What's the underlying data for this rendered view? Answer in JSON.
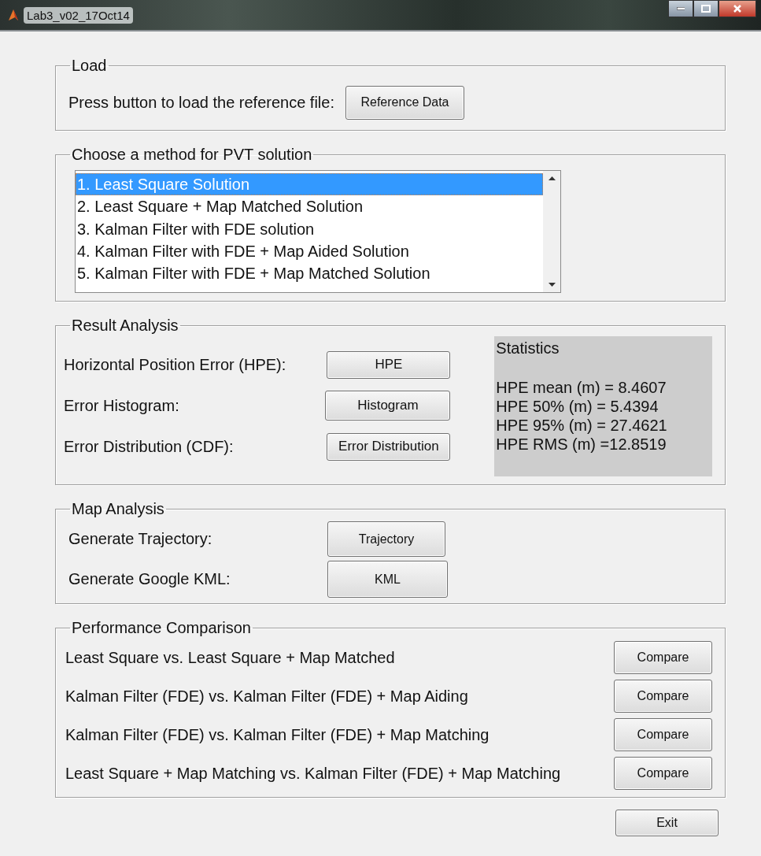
{
  "window": {
    "title": "Lab3_v02_17Oct14"
  },
  "load": {
    "title": "Load",
    "label": "Press button to load the reference file:",
    "button": "Reference Data"
  },
  "method": {
    "title": "Choose a method for PVT solution",
    "items": [
      {
        "label": "1. Least Square Solution",
        "selected": true
      },
      {
        "label": "2. Least Square + Map Matched Solution",
        "selected": false
      },
      {
        "label": "3. Kalman Filter with FDE solution",
        "selected": false
      },
      {
        "label": "4. Kalman Filter with FDE + Map Aided Solution",
        "selected": false
      },
      {
        "label": "5. Kalman Filter with FDE + Map Matched Solution",
        "selected": false
      }
    ]
  },
  "result": {
    "title": "Result Analysis",
    "rows": [
      {
        "label": "Horizontal Position Error (HPE):",
        "button": "HPE"
      },
      {
        "label": "Error Histogram:",
        "button": "Histogram"
      },
      {
        "label": "Error Distribution (CDF):",
        "button": "Error Distribution"
      }
    ],
    "statistics": {
      "title": "Statistics",
      "lines": [
        "HPE mean (m) = 8.4607",
        "HPE 50% (m) = 5.4394",
        "HPE 95% (m) = 27.4621",
        "HPE RMS (m) =12.8519"
      ]
    }
  },
  "map": {
    "title": "Map Analysis",
    "rows": [
      {
        "label": "Generate Trajectory:",
        "button": "Trajectory"
      },
      {
        "label": "Generate Google KML:",
        "button": "KML"
      }
    ]
  },
  "comparison": {
    "title": "Performance Comparison",
    "rows": [
      {
        "label": "Least Square vs. Least Square + Map Matched",
        "button": "Compare"
      },
      {
        "label": "Kalman Filter (FDE) vs. Kalman Filter (FDE) + Map Aiding",
        "button": "Compare"
      },
      {
        "label": "Kalman Filter (FDE) vs. Kalman Filter (FDE) + Map Matching",
        "button": "Compare"
      },
      {
        "label": "Least Square + Map Matching vs. Kalman Filter (FDE) + Map Matching",
        "button": "Compare"
      }
    ]
  },
  "exit_button": "Exit"
}
